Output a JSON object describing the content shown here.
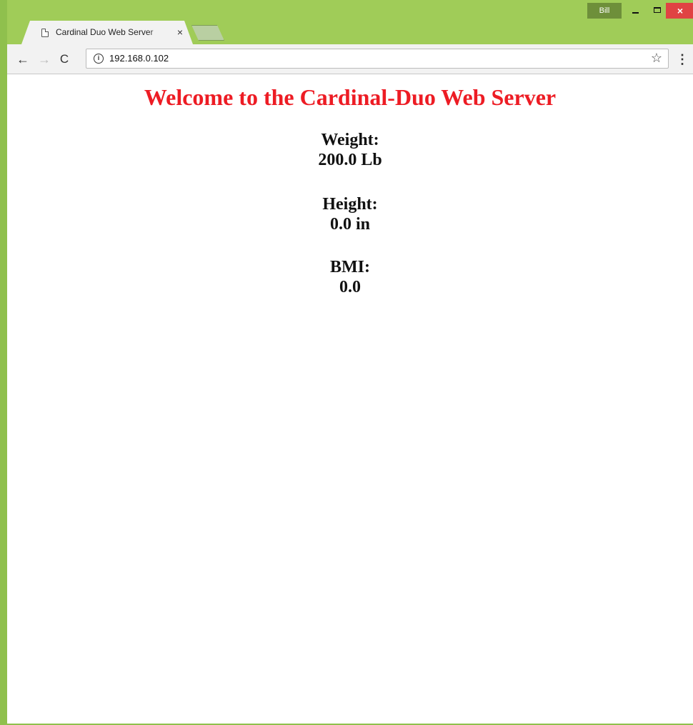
{
  "browser": {
    "tab_title": "Cardinal Duo Web Server",
    "tab_close_glyph": "×",
    "profile_name": "Bill",
    "window_close_glyph": "×",
    "url": "192.168.0.102",
    "icons": {
      "back": "arrow-left-icon",
      "forward": "arrow-right-icon",
      "reload": "reload-icon",
      "site_info": "info-icon",
      "bookmark": "star-icon",
      "menu": "kebab-menu-icon"
    },
    "glyphs": {
      "back": "←",
      "forward": "→",
      "reload": "C",
      "info": "i",
      "star": "☆",
      "menu": "⋮"
    },
    "colors": {
      "frame": "#a0cc58",
      "close_button": "#e04343",
      "profile_badge": "#6e8f3a"
    }
  },
  "page": {
    "title": "Welcome to the Cardinal-Duo Web Server",
    "title_color": "#ed1c24",
    "weight": {
      "label": "Weight:",
      "value": "200.0 Lb"
    },
    "height": {
      "label": "Height:",
      "value": "0.0 in"
    },
    "bmi": {
      "label": "BMI:",
      "value": "0.0"
    }
  }
}
